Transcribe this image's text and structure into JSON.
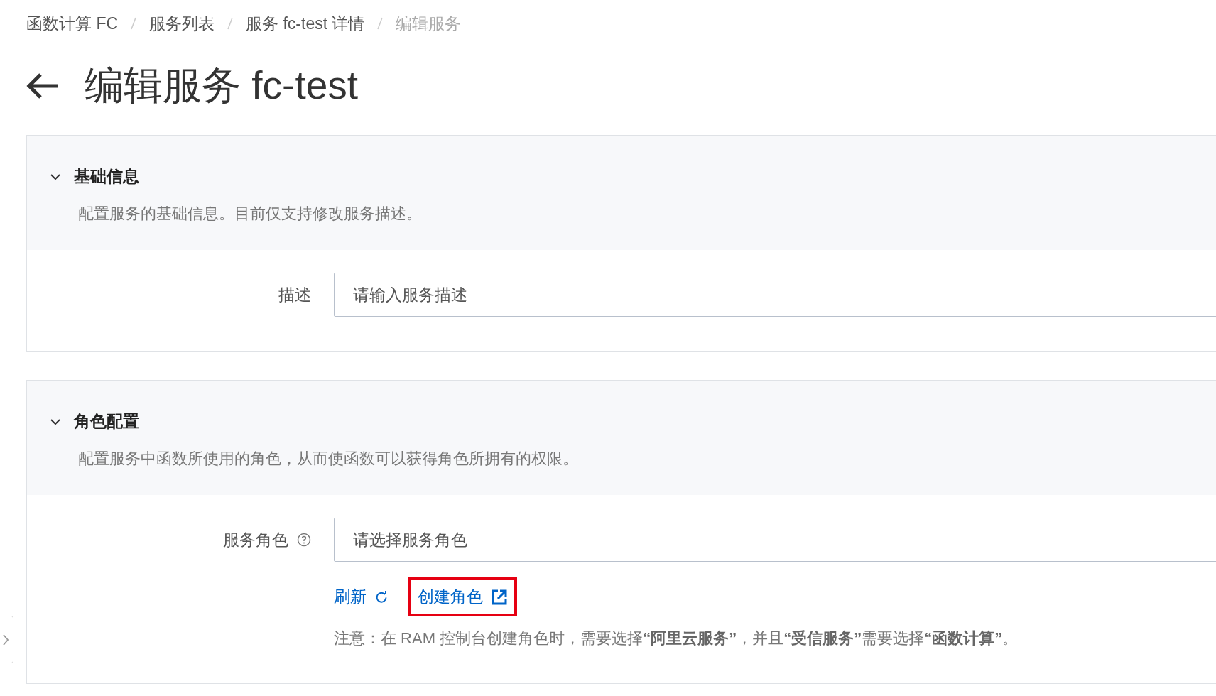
{
  "breadcrumb": [
    {
      "label": "函数计算 FC",
      "current": false
    },
    {
      "label": "服务列表",
      "current": false
    },
    {
      "label": "服务 fc-test 详情",
      "current": false
    },
    {
      "label": "编辑服务",
      "current": true
    }
  ],
  "title": "编辑服务 fc-test",
  "sections": [
    {
      "title": "基础信息",
      "expanded": true,
      "description": "配置服务的基础信息。目前仅支持修改服务描述。",
      "fields": [
        {
          "label": "描述",
          "help": false,
          "placeholder": "请输入服务描述"
        }
      ]
    },
    {
      "title": "角色配置",
      "expanded": true,
      "description": "配置服务中函数所使用的角色，从而使函数可以获得角色所拥有的权限。",
      "fields": [
        {
          "label": "服务角色",
          "help": true,
          "placeholder": "请选择服务角色"
        }
      ],
      "links": [
        {
          "label": "刷新",
          "kind": "refresh",
          "highlighted": false
        },
        {
          "label": "创建角色",
          "kind": "external",
          "highlighted": true
        }
      ],
      "note": "注意：在 RAM 控制台创建角色时，需要选择**“阿里云服务”**，并且**“受信服务”**需要选择**“函数计算”**。"
    }
  ]
}
